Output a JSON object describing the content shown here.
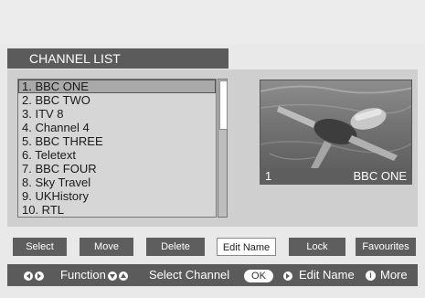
{
  "title": "CHANNEL LIST",
  "channels": [
    {
      "label": "1. BBC ONE"
    },
    {
      "label": "2. BBC TWO"
    },
    {
      "label": "3. ITV 8"
    },
    {
      "label": "4. Channel 4"
    },
    {
      "label": "5. BBC THREE"
    },
    {
      "label": "6. Teletext"
    },
    {
      "label": "7. BBC FOUR"
    },
    {
      "label": "8. Sky Travel"
    },
    {
      "label": "9. UKHistory"
    },
    {
      "label": "10. RTL"
    }
  ],
  "preview": {
    "number": "1",
    "name": "BBC ONE"
  },
  "buttons": {
    "select": "Select",
    "move": "Move",
    "delete": "Delete",
    "edit_name": "Edit Name",
    "lock": "Lock",
    "favourites": "Favourites"
  },
  "footer": {
    "function": "Function",
    "select_channel": "Select Channel",
    "ok": "OK",
    "edit_name": "Edit Name",
    "info_glyph": "i",
    "more": "More"
  }
}
